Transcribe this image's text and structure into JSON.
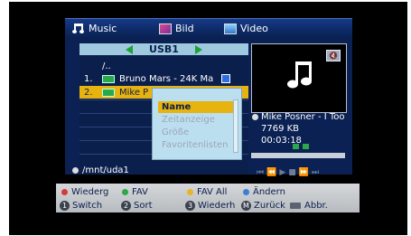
{
  "tabs": [
    {
      "label": "Music",
      "icon": "music-note-icon"
    },
    {
      "label": "Bild",
      "icon": "picture-icon"
    },
    {
      "label": "Video",
      "icon": "video-icon"
    }
  ],
  "filelist": {
    "source": "USB1",
    "rows": [
      {
        "num": "",
        "name": "/.."
      },
      {
        "num": "1.",
        "name": "Bruno Mars - 24K Ma"
      },
      {
        "num": "2.",
        "name": "Mike P"
      }
    ]
  },
  "context_menu": {
    "items": [
      "Name",
      "Zeitanzeige",
      "Größe",
      "Favoritenlisten"
    ],
    "selected": "Name"
  },
  "now_playing": {
    "title": "Mike Posner - I Too",
    "size": "7769 KB",
    "duration": "00:03:18"
  },
  "path": "/mnt/uda1",
  "transport_icons": [
    "previous-icon",
    "rewind-icon",
    "play-icon",
    "stop-icon",
    "fast-forward-icon",
    "next-icon"
  ],
  "footer": {
    "row1": [
      {
        "color": "#d83a3a",
        "label": "Wiederg"
      },
      {
        "color": "#2aa84a",
        "label": "FAV"
      },
      {
        "color": "#e8b526",
        "label": "FAV All"
      },
      {
        "color": "#3a7fd8",
        "label": "Ändern"
      }
    ],
    "row2": [
      {
        "key": "1",
        "label": "Switch"
      },
      {
        "key": "2",
        "label": "Sort"
      },
      {
        "key": "3",
        "label": "Wiederh"
      },
      {
        "key": "M",
        "label": "Zurück"
      },
      {
        "key": "",
        "label": "Abbr."
      }
    ]
  },
  "colors": {
    "panel": "#0b2153",
    "highlight": "#e7b30f",
    "header": "#9ec9df"
  }
}
